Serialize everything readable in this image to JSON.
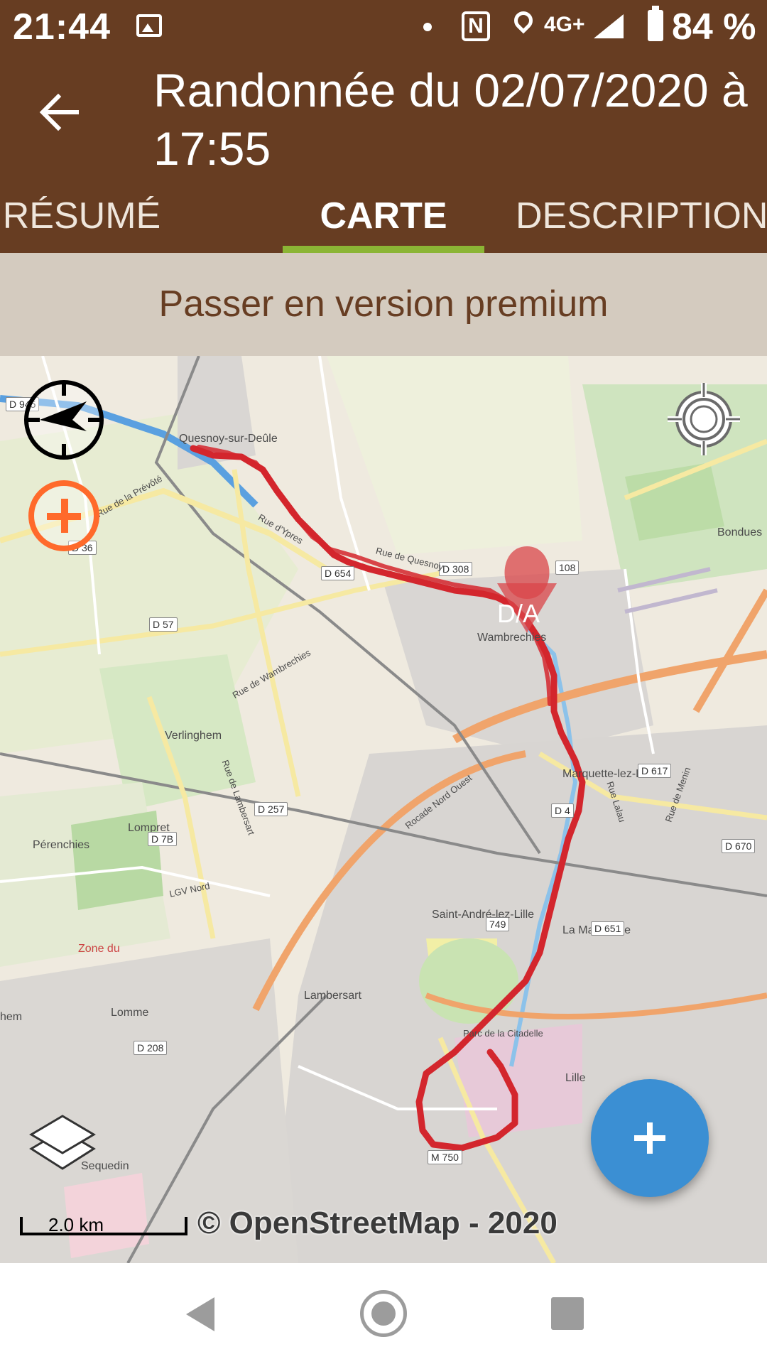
{
  "status_bar": {
    "time": "21:44",
    "network": "4G+",
    "battery": "84 %",
    "icons": [
      "image-icon",
      "dot-icon",
      "nfc-icon",
      "location-icon",
      "signal-icon",
      "battery-icon"
    ]
  },
  "app_bar": {
    "title": "Randonnée du 02/07/2020 à 17:55",
    "back_icon": "arrow-back-icon",
    "tabs": [
      {
        "label": "RÉSUMÉ",
        "active": false
      },
      {
        "label": "CARTE",
        "active": true
      },
      {
        "label": "DESCRIPTION",
        "active": false
      }
    ],
    "accent_color": "#8bb535",
    "bar_color": "#673d22"
  },
  "banner": {
    "text": "Passer en version premium"
  },
  "map": {
    "marker_label": "D/A",
    "scale_label": "2.0 km",
    "attribution": "© OpenStreetMap - 2020",
    "track_color": "#d3262d",
    "fab_color": "#3b8fd3",
    "places": [
      "Quesnoy-sur-Deûle",
      "Bondues",
      "Wambrechies",
      "Verlinghem",
      "Marquette-lez-Lille",
      "Lompret",
      "Pérenchies",
      "Saint-André-lez-Lille",
      "La Madeleine",
      "Lambersart",
      "Lomme",
      "Lille",
      "Sequedin",
      "Parc de la Citadelle",
      "Zone du",
      "hem"
    ],
    "roads": [
      "D 945",
      "D 36",
      "D 654",
      "D 308",
      "D 57",
      "D 257",
      "D 7B",
      "D 617",
      "D 670",
      "D 651",
      "D 208",
      "M 750",
      "749",
      "108",
      "D 4"
    ],
    "streets": [
      "Rue de la Prévôté",
      "Rue d'Ypres",
      "Rue de Quesnoy",
      "Rue de Wambrechies",
      "Rue de Lambersart",
      "Rocade Nord Ouest",
      "LGV Nord",
      "Rue Lalau",
      "Rue de Menin"
    ],
    "controls": [
      "compass-icon",
      "zoom-in-icon",
      "my-location-icon",
      "layers-icon",
      "add-icon"
    ]
  },
  "nav_bar": {
    "icons": [
      "nav-back-icon",
      "nav-home-icon",
      "nav-recent-icon"
    ]
  }
}
